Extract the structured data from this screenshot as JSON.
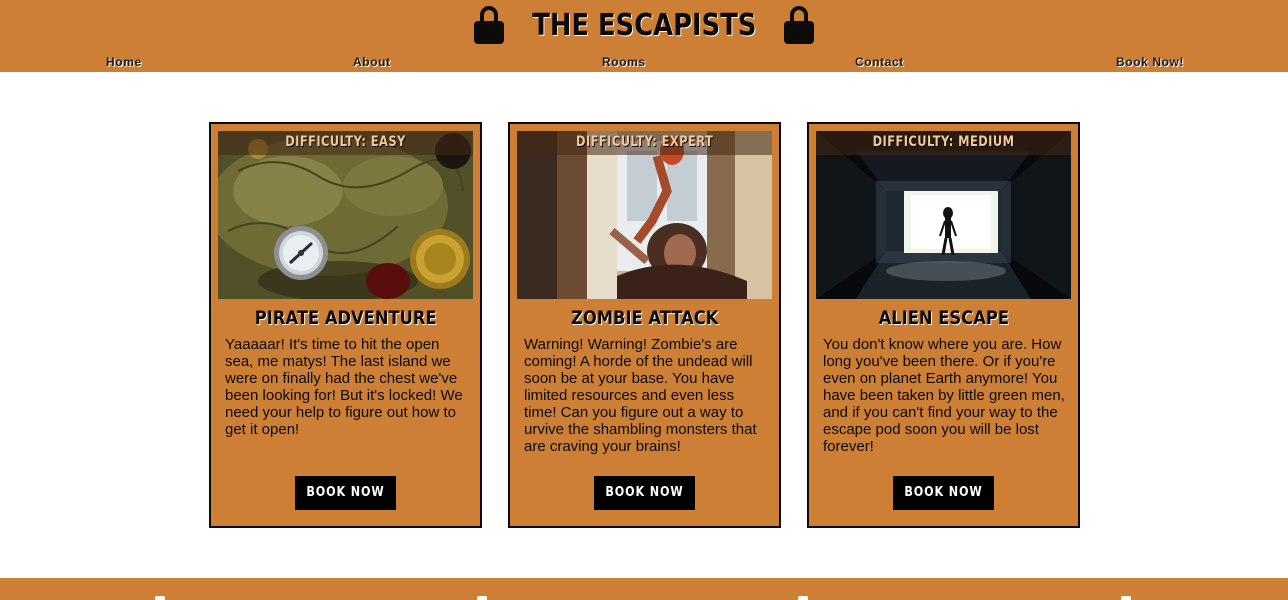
{
  "brand": {
    "title": "THE ESCAPISTS",
    "left_icon": "lock-icon",
    "right_icon": "lock-icon"
  },
  "nav": {
    "items": [
      {
        "label": "Home"
      },
      {
        "label": "About"
      },
      {
        "label": "Rooms"
      },
      {
        "label": "Contact"
      },
      {
        "label": "Book Now!"
      }
    ]
  },
  "rooms": [
    {
      "difficulty": "DIFFICULTY: EASY",
      "title": "PIRATE ADVENTURE",
      "description": "Yaaaaar! It's time to hit the open sea, me matys! The last island we were on finally had the chest we've been looking for! But it's locked! We need your help to figure out how to get it open!",
      "button": "BOOK NOW",
      "image": "pirate-map-compass-image"
    },
    {
      "difficulty": "DIFFICULTY: EXPERT",
      "title": "ZOMBIE ATTACK",
      "description": "Warning! Warning! Zombie's are coming! A horde of the undead will soon be at your base. You have limited resources and even less time! Can you figure out a way to urvive the shambling monsters that are craving your brains!",
      "button": "BOOK NOW",
      "image": "zombie-window-image"
    },
    {
      "difficulty": "DIFFICULTY: MEDIUM",
      "title": "ALIEN ESCAPE",
      "description": "You don't know where you are. How long you've been there. Or if you're even on planet Earth anymore! You have been taken by little green men, and if you can't find your way to the escape pod soon you will be lost forever!",
      "button": "BOOK NOW",
      "image": "alien-tunnel-image"
    }
  ],
  "colors": {
    "accent": "#cd7f35",
    "text": "#0b0b0b",
    "button": "#000000",
    "background": "#ffffff"
  }
}
